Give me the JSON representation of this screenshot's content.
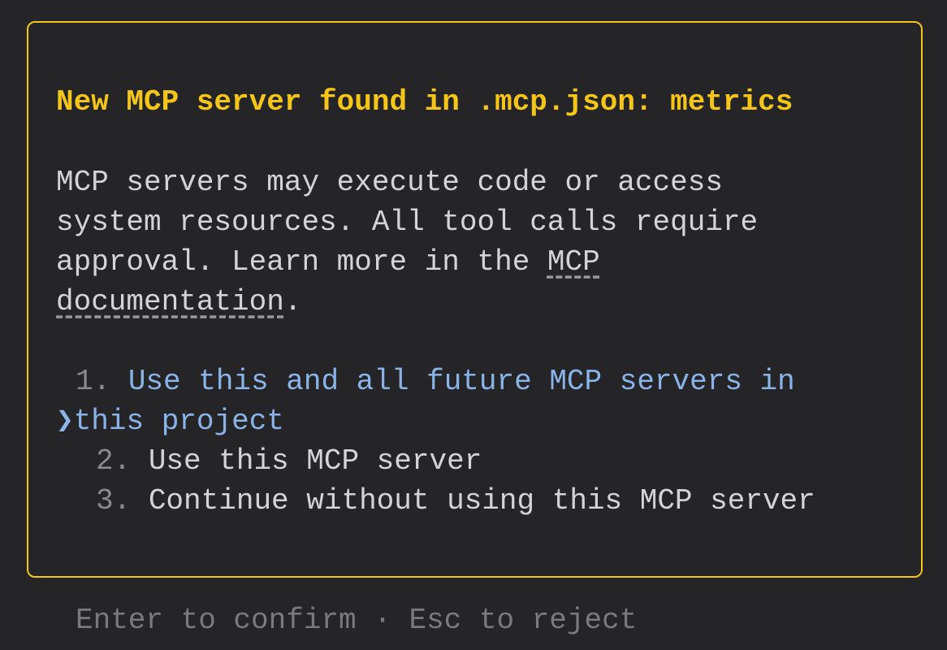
{
  "dialog": {
    "title": "New MCP server found in .mcp.json: metrics",
    "body": {
      "line1": "MCP servers may execute code or access",
      "line2": "system resources. All tool calls require",
      "line3_prefix": "approval. Learn more in the ",
      "link_part1": "MCP",
      "link_part2": "documentation",
      "line4_suffix": "."
    },
    "options": [
      {
        "number": "1.",
        "label_line1": "Use this and all future MCP servers in",
        "label_line2": "this project",
        "selected": true
      },
      {
        "number": "2.",
        "label": "Use this MCP server",
        "selected": false
      },
      {
        "number": "3.",
        "label": "Continue without using this MCP server",
        "selected": false
      }
    ],
    "pointer_glyph": "❯"
  },
  "footer": {
    "hint": "Enter to confirm · Esc to reject"
  },
  "colors": {
    "background": "#252528",
    "border": "#f5c518",
    "title": "#f5c518",
    "selected": "#8ab4e8",
    "text": "#d4d4d4",
    "muted": "#7a7a7a"
  }
}
